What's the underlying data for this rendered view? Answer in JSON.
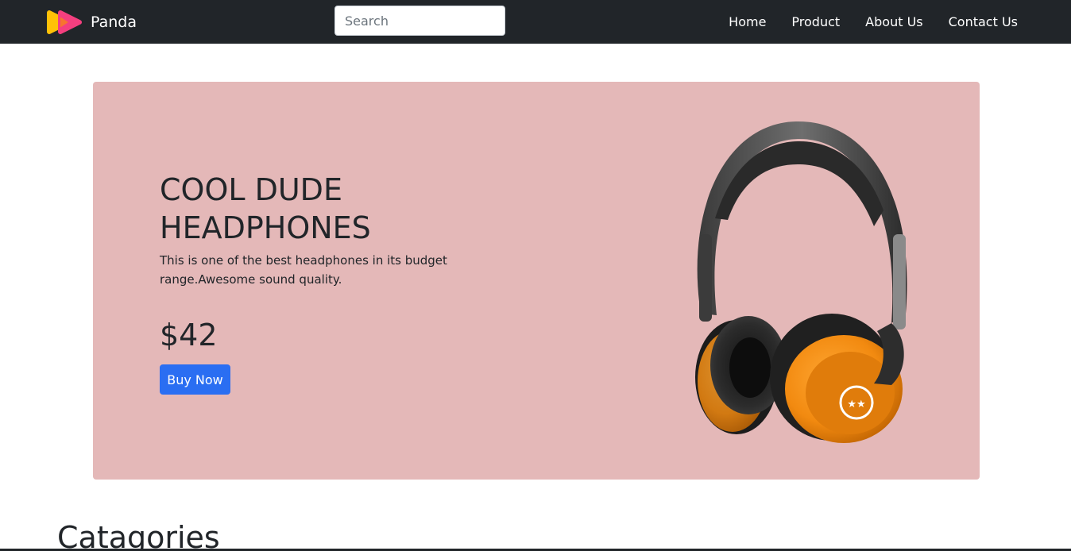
{
  "navbar": {
    "brand": {
      "name": "Panda",
      "logo_icon": "panda-play-logo-icon",
      "logo_colors": [
        "#ffc107",
        "#f43f7f"
      ]
    },
    "search": {
      "placeholder": "Search",
      "value": ""
    },
    "links": [
      {
        "label": "Home"
      },
      {
        "label": "Product"
      },
      {
        "label": "About Us"
      },
      {
        "label": "Contact Us"
      }
    ],
    "background": "#212529"
  },
  "hero": {
    "title": "COOL DUDE HEADPHONES",
    "description": "This is one of the best headphones in its budget range.Awesome sound quality.",
    "price": "$42",
    "button_label": "Buy Now",
    "image_icon": "headphones-image",
    "background": "#e4b8b8",
    "accent": "#2a6ef2"
  },
  "categories": {
    "title": "Catagories"
  }
}
